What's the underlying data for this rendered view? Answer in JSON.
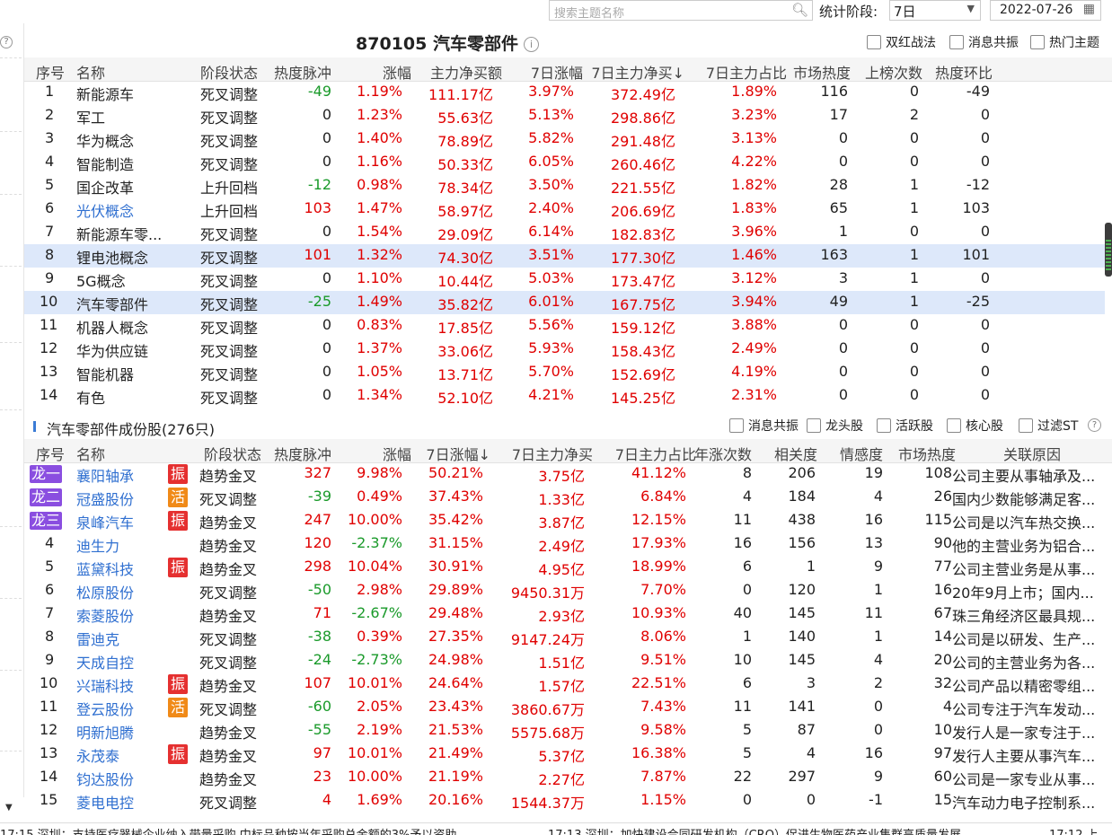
{
  "toolbar": {
    "search_placeholder": "搜索主题名称",
    "stat_label": "统计阶段:",
    "stat_value": "7日",
    "date_value": "2022-07-26"
  },
  "title": {
    "code": "870105",
    "name": "汽车零部件"
  },
  "filters_top": [
    "双红战法",
    "消息共振",
    "热门主题"
  ],
  "columns_top": [
    "序号",
    "名称",
    "阶段状态",
    "热度脉冲",
    "涨幅",
    "主力净买额",
    "7日涨幅",
    "7日主力净买↓",
    "7日主力占比",
    "市场热度",
    "上榜次数",
    "热度环比"
  ],
  "themes": [
    {
      "no": "1",
      "name": "新能源车",
      "stage": "死叉调整",
      "pulse": "-49",
      "chg": "1.19%",
      "net": "111.17亿",
      "chg7": "3.97%",
      "net7": "372.49亿",
      "ratio7": "1.89%",
      "heat": "116",
      "times": "0",
      "hb": "-49"
    },
    {
      "no": "2",
      "name": "军工",
      "stage": "死叉调整",
      "pulse": "0",
      "chg": "1.23%",
      "net": "55.63亿",
      "chg7": "5.13%",
      "net7": "298.86亿",
      "ratio7": "3.23%",
      "heat": "17",
      "times": "2",
      "hb": "0"
    },
    {
      "no": "3",
      "name": "华为概念",
      "stage": "死叉调整",
      "pulse": "0",
      "chg": "1.40%",
      "net": "78.89亿",
      "chg7": "5.82%",
      "net7": "291.48亿",
      "ratio7": "3.13%",
      "heat": "0",
      "times": "0",
      "hb": "0"
    },
    {
      "no": "4",
      "name": "智能制造",
      "stage": "死叉调整",
      "pulse": "0",
      "chg": "1.16%",
      "net": "50.33亿",
      "chg7": "6.05%",
      "net7": "260.46亿",
      "ratio7": "4.22%",
      "heat": "0",
      "times": "0",
      "hb": "0"
    },
    {
      "no": "5",
      "name": "国企改革",
      "stage": "上升回档",
      "pulse": "-12",
      "chg": "0.98%",
      "net": "78.34亿",
      "chg7": "3.50%",
      "net7": "221.55亿",
      "ratio7": "1.82%",
      "heat": "28",
      "times": "1",
      "hb": "-12"
    },
    {
      "no": "6",
      "name": "光伏概念",
      "stage": "上升回档",
      "pulse": "103",
      "chg": "1.47%",
      "net": "58.97亿",
      "chg7": "2.40%",
      "net7": "206.69亿",
      "ratio7": "1.83%",
      "heat": "65",
      "times": "1",
      "hb": "103"
    },
    {
      "no": "7",
      "name": "新能源车零...",
      "stage": "死叉调整",
      "pulse": "0",
      "chg": "1.54%",
      "net": "29.09亿",
      "chg7": "6.14%",
      "net7": "182.83亿",
      "ratio7": "3.96%",
      "heat": "1",
      "times": "0",
      "hb": "0"
    },
    {
      "no": "8",
      "name": "锂电池概念",
      "stage": "死叉调整",
      "pulse": "101",
      "chg": "1.32%",
      "net": "74.30亿",
      "chg7": "3.51%",
      "net7": "177.30亿",
      "ratio7": "1.46%",
      "heat": "163",
      "times": "1",
      "hb": "101"
    },
    {
      "no": "9",
      "name": "5G概念",
      "stage": "死叉调整",
      "pulse": "0",
      "chg": "1.10%",
      "net": "10.44亿",
      "chg7": "5.03%",
      "net7": "173.47亿",
      "ratio7": "3.12%",
      "heat": "3",
      "times": "1",
      "hb": "0"
    },
    {
      "no": "10",
      "name": "汽车零部件",
      "stage": "死叉调整",
      "pulse": "-25",
      "chg": "1.49%",
      "net": "35.82亿",
      "chg7": "6.01%",
      "net7": "167.75亿",
      "ratio7": "3.94%",
      "heat": "49",
      "times": "1",
      "hb": "-25"
    },
    {
      "no": "11",
      "name": "机器人概念",
      "stage": "死叉调整",
      "pulse": "0",
      "chg": "0.83%",
      "net": "17.85亿",
      "chg7": "5.56%",
      "net7": "159.12亿",
      "ratio7": "3.88%",
      "heat": "0",
      "times": "0",
      "hb": "0"
    },
    {
      "no": "12",
      "name": "华为供应链",
      "stage": "死叉调整",
      "pulse": "0",
      "chg": "1.37%",
      "net": "33.06亿",
      "chg7": "5.93%",
      "net7": "158.43亿",
      "ratio7": "2.49%",
      "heat": "0",
      "times": "0",
      "hb": "0"
    },
    {
      "no": "13",
      "name": "智能机器",
      "stage": "死叉调整",
      "pulse": "0",
      "chg": "1.05%",
      "net": "13.71亿",
      "chg7": "5.70%",
      "net7": "152.69亿",
      "ratio7": "4.19%",
      "heat": "0",
      "times": "0",
      "hb": "0"
    },
    {
      "no": "14",
      "name": "有色",
      "stage": "死叉调整",
      "pulse": "0",
      "chg": "1.34%",
      "net": "52.10亿",
      "chg7": "4.21%",
      "net7": "145.25亿",
      "ratio7": "2.31%",
      "heat": "0",
      "times": "0",
      "hb": "0"
    }
  ],
  "sub_title": "汽车零部件成份股(276只)",
  "filters_sub": [
    "消息共振",
    "龙头股",
    "活跃股",
    "核心股",
    "过滤ST"
  ],
  "columns_sub": [
    "序号",
    "名称",
    "阶段状态",
    "热度脉冲",
    "涨幅",
    "7日涨幅↓",
    "7日主力净买",
    "7日主力占比",
    "年涨次数",
    "相关度",
    "情感度",
    "市场热度",
    "关联原因"
  ],
  "stocks": [
    {
      "no": "龙一",
      "name": "襄阳轴承",
      "badge": "振",
      "stage": "趋势金叉",
      "pulse": "327",
      "chg": "9.98%",
      "chg7": "50.21%",
      "net7": "3.75亿",
      "ratio7": "41.12%",
      "ytimes": "8",
      "rel": "206",
      "emo": "19",
      "heat": "108",
      "reason": "公司主要从事轴承及..."
    },
    {
      "no": "龙二",
      "name": "冠盛股份",
      "badge": "活",
      "stage": "死叉调整",
      "pulse": "-39",
      "chg": "0.49%",
      "chg7": "37.43%",
      "net7": "1.33亿",
      "ratio7": "6.84%",
      "ytimes": "4",
      "rel": "184",
      "emo": "4",
      "heat": "26",
      "reason": "国内少数能够满足客..."
    },
    {
      "no": "龙三",
      "name": "泉峰汽车",
      "badge": "振",
      "stage": "趋势金叉",
      "pulse": "247",
      "chg": "10.00%",
      "chg7": "35.42%",
      "net7": "3.87亿",
      "ratio7": "12.15%",
      "ytimes": "11",
      "rel": "438",
      "emo": "16",
      "heat": "115",
      "reason": "公司是以汽车热交换..."
    },
    {
      "no": "4",
      "name": "迪生力",
      "badge": "",
      "stage": "趋势金叉",
      "pulse": "120",
      "chg": "-2.37%",
      "chg7": "31.15%",
      "net7": "2.49亿",
      "ratio7": "17.93%",
      "ytimes": "16",
      "rel": "156",
      "emo": "13",
      "heat": "90",
      "reason": "他的主营业务为铝合..."
    },
    {
      "no": "5",
      "name": "蓝黛科技",
      "badge": "振",
      "stage": "趋势金叉",
      "pulse": "298",
      "chg": "10.04%",
      "chg7": "30.91%",
      "net7": "4.95亿",
      "ratio7": "18.99%",
      "ytimes": "6",
      "rel": "1",
      "emo": "9",
      "heat": "77",
      "reason": "公司主营业务是从事..."
    },
    {
      "no": "6",
      "name": "松原股份",
      "badge": "",
      "stage": "死叉调整",
      "pulse": "-50",
      "chg": "2.98%",
      "chg7": "29.89%",
      "net7": "9450.31万",
      "ratio7": "7.70%",
      "ytimes": "0",
      "rel": "120",
      "emo": "1",
      "heat": "16",
      "reason": "20年9月上市；国内..."
    },
    {
      "no": "7",
      "name": "索菱股份",
      "badge": "",
      "stage": "趋势金叉",
      "pulse": "71",
      "chg": "-2.67%",
      "chg7": "29.48%",
      "net7": "2.93亿",
      "ratio7": "10.93%",
      "ytimes": "40",
      "rel": "145",
      "emo": "11",
      "heat": "67",
      "reason": "珠三角经济区最具规..."
    },
    {
      "no": "8",
      "name": "雷迪克",
      "badge": "",
      "stage": "死叉调整",
      "pulse": "-38",
      "chg": "0.39%",
      "chg7": "27.35%",
      "net7": "9147.24万",
      "ratio7": "8.06%",
      "ytimes": "1",
      "rel": "140",
      "emo": "1",
      "heat": "14",
      "reason": "公司是以研发、生产..."
    },
    {
      "no": "9",
      "name": "天成自控",
      "badge": "",
      "stage": "死叉调整",
      "pulse": "-24",
      "chg": "-2.73%",
      "chg7": "24.98%",
      "net7": "1.51亿",
      "ratio7": "9.51%",
      "ytimes": "10",
      "rel": "145",
      "emo": "4",
      "heat": "20",
      "reason": "公司的主营业务为各..."
    },
    {
      "no": "10",
      "name": "兴瑞科技",
      "badge": "振",
      "stage": "趋势金叉",
      "pulse": "107",
      "chg": "10.01%",
      "chg7": "24.64%",
      "net7": "1.57亿",
      "ratio7": "22.51%",
      "ytimes": "6",
      "rel": "3",
      "emo": "2",
      "heat": "32",
      "reason": "公司产品以精密零组..."
    },
    {
      "no": "11",
      "name": "登云股份",
      "badge": "活",
      "stage": "死叉调整",
      "pulse": "-60",
      "chg": "2.05%",
      "chg7": "23.43%",
      "net7": "3860.67万",
      "ratio7": "7.43%",
      "ytimes": "11",
      "rel": "141",
      "emo": "0",
      "heat": "4",
      "reason": "公司专注于汽车发动..."
    },
    {
      "no": "12",
      "name": "明新旭腾",
      "badge": "",
      "stage": "趋势金叉",
      "pulse": "-55",
      "chg": "2.19%",
      "chg7": "21.53%",
      "net7": "5575.68万",
      "ratio7": "9.58%",
      "ytimes": "5",
      "rel": "87",
      "emo": "0",
      "heat": "10",
      "reason": "发行人是一家专注于..."
    },
    {
      "no": "13",
      "name": "永茂泰",
      "badge": "振",
      "stage": "趋势金叉",
      "pulse": "97",
      "chg": "10.01%",
      "chg7": "21.49%",
      "net7": "5.37亿",
      "ratio7": "16.38%",
      "ytimes": "5",
      "rel": "4",
      "emo": "16",
      "heat": "97",
      "reason": "发行人主要从事汽车..."
    },
    {
      "no": "14",
      "name": "钧达股份",
      "badge": "",
      "stage": "趋势金叉",
      "pulse": "23",
      "chg": "10.00%",
      "chg7": "21.19%",
      "net7": "2.27亿",
      "ratio7": "7.87%",
      "ytimes": "22",
      "rel": "297",
      "emo": "9",
      "heat": "60",
      "reason": "公司是一家专业从事..."
    },
    {
      "no": "15",
      "name": "菱电电控",
      "badge": "",
      "stage": "死叉调整",
      "pulse": "4",
      "chg": "1.69%",
      "chg7": "20.16%",
      "net7": "1544.37万",
      "ratio7": "1.15%",
      "ytimes": "0",
      "rel": "0",
      "emo": "-1",
      "heat": "15",
      "reason": "汽车动力电子控制系..."
    }
  ],
  "ticker": [
    "17:15 深圳：支持医疗器械企业纳入带量采购 中标品种按当年采购总金额的3%予以资助",
    "17:13 深圳：加快建设合同研发机构（CRO）促进生物医药产业集群高质量发展",
    "17:12 上"
  ],
  "colors": {
    "up": "#e00000",
    "down": "#1a9a2a",
    "link": "#2f6fd0",
    "highlight": "#dde8fa",
    "dragon": "#8a4ee0",
    "zhen": "#e53030",
    "huo": "#f08a18"
  }
}
